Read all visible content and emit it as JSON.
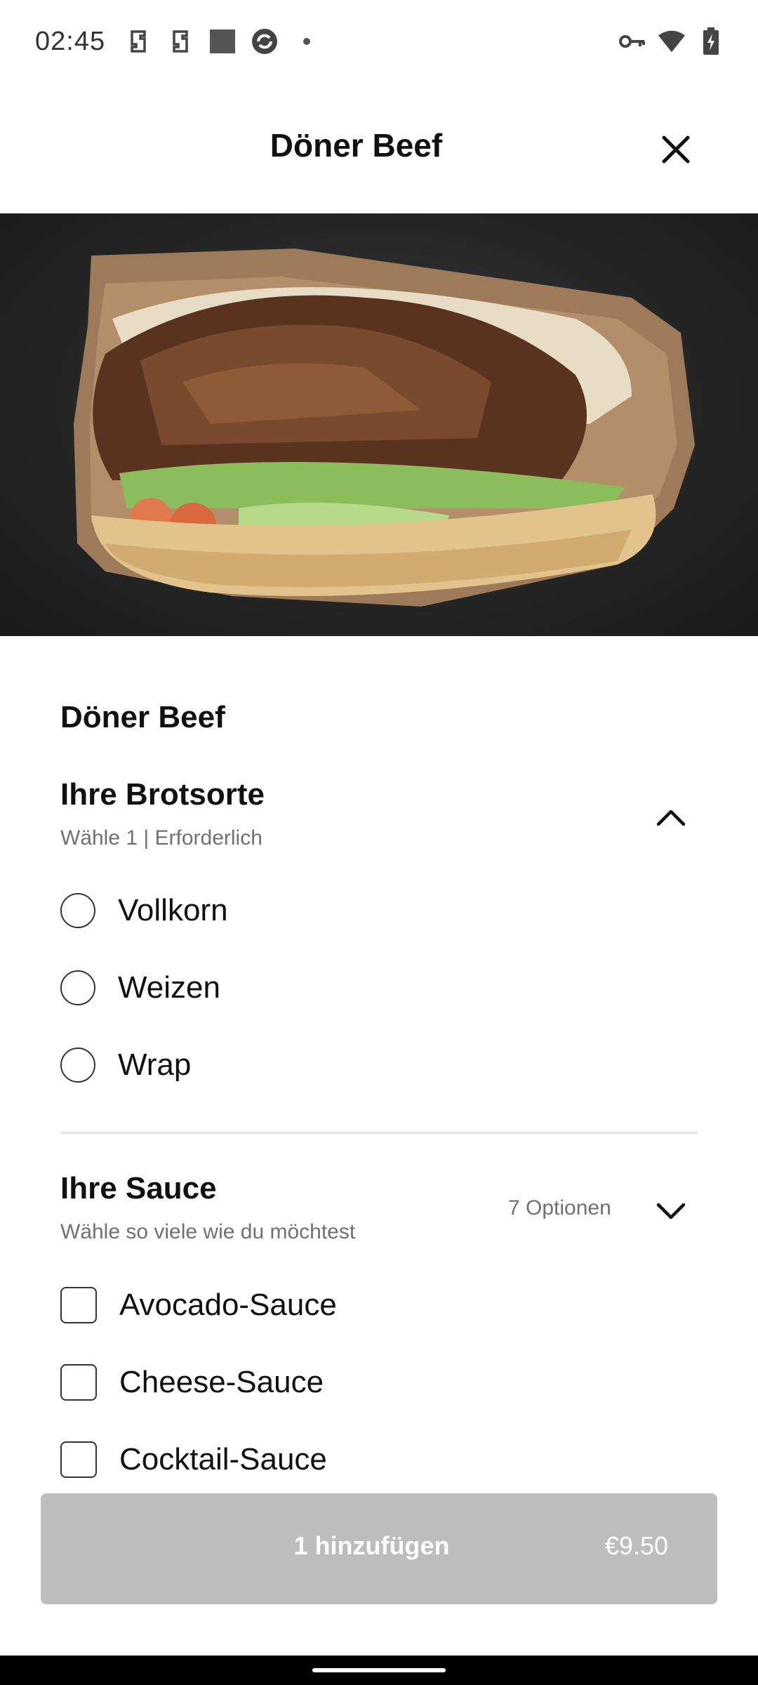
{
  "status_bar": {
    "time": "02:45",
    "left_icons": [
      "bracket-app-icon",
      "bracket-app-icon",
      "square-notification-icon",
      "sync-app-icon",
      "dot-icon"
    ],
    "right_icons": [
      "key-icon",
      "wifi-icon",
      "battery-charging-icon"
    ]
  },
  "header": {
    "title": "Döner Beef",
    "close_icon": "close-icon"
  },
  "hero_image": {
    "alt": "doner-beef-sandwich"
  },
  "item": {
    "title": "Döner Beef"
  },
  "bread_section": {
    "title": "Ihre Brotsorte",
    "subtitle": "Wähle 1  |  Erforderlich",
    "expanded": true,
    "options": [
      {
        "label": "Vollkorn",
        "selected": false
      },
      {
        "label": "Weizen",
        "selected": false
      },
      {
        "label": "Wrap",
        "selected": false
      }
    ]
  },
  "sauce_section": {
    "title": "Ihre Sauce",
    "subtitle": "Wähle so viele wie du möchtest",
    "option_count": "7 Optionen",
    "options": [
      {
        "label": "Avocado-Sauce",
        "checked": false
      },
      {
        "label": "Cheese-Sauce",
        "checked": false
      },
      {
        "label": "Cocktail-Sauce",
        "checked": false
      }
    ]
  },
  "footer": {
    "add_label": "1 hinzufügen",
    "price": "€9.50",
    "button_color": "#bdbdbd"
  }
}
